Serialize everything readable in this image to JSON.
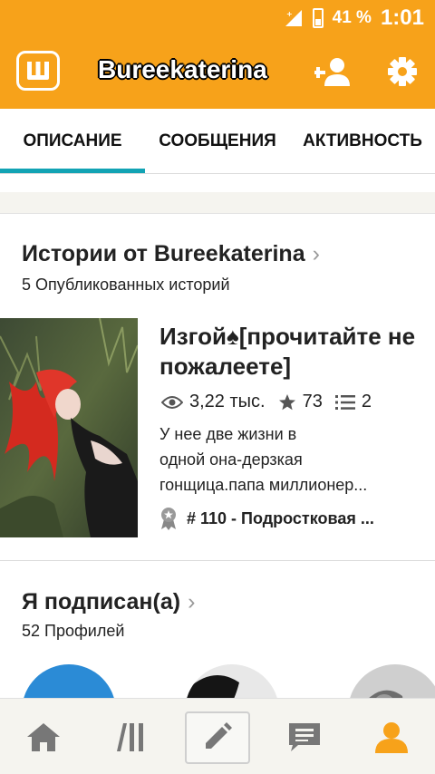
{
  "status_bar": {
    "battery_percent": "41 %",
    "time": "1:01"
  },
  "app_bar": {
    "title": "Bureekaterina",
    "logo_icon": "wattpad-logo-icon",
    "add_user_icon": "add-user-icon",
    "settings_icon": "gear-icon"
  },
  "tabs": [
    {
      "label": "ОПИСАНИЕ",
      "active": true
    },
    {
      "label": "СООБЩЕНИЯ",
      "active": false
    },
    {
      "label": "АКТИВНОСТЬ",
      "active": false
    }
  ],
  "stories": {
    "title": "Истории от Bureekaterina",
    "subtitle": "5 Опубликованных историй",
    "item": {
      "title": "Изгой♠[прочитайте не пожалеете]",
      "views": "3,22 тыс.",
      "votes": "73",
      "parts": "2",
      "description_lines": [
        "У нее две жизни в",
        "одной она-дерзкая",
        "гонщица.папа миллионер..."
      ],
      "rank": "# 110 - Подростковая ..."
    }
  },
  "following": {
    "title": "Я подписан(а)",
    "subtitle": "52 Профилей"
  },
  "bottom_nav": [
    "home-icon",
    "library-icon",
    "write-icon",
    "messages-icon",
    "profile-icon"
  ],
  "colors": {
    "accent": "#f7a21a",
    "tab_indicator": "#12a3b4",
    "active_nav": "#f7a21a",
    "inactive_nav": "#777777"
  }
}
